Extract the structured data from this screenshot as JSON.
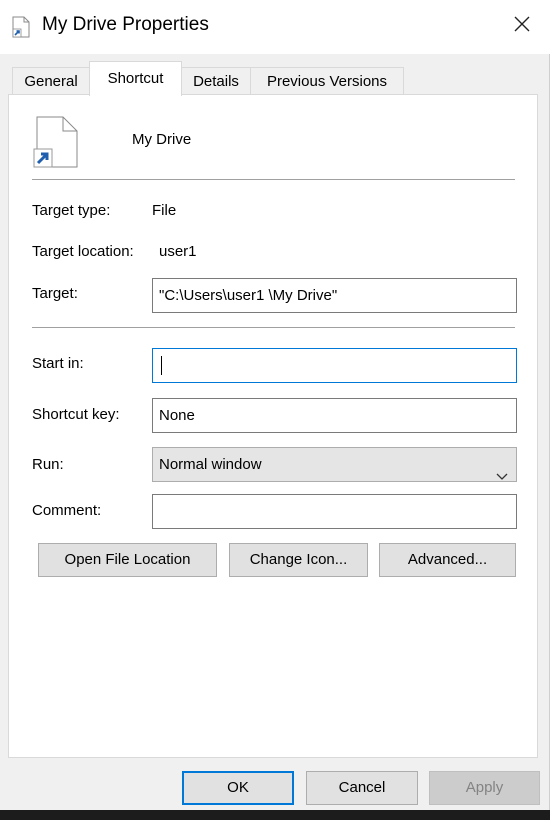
{
  "window": {
    "title": "My Drive Properties"
  },
  "tabs": [
    {
      "label": "General",
      "active": false
    },
    {
      "label": "Shortcut",
      "active": true
    },
    {
      "label": "Details",
      "active": false
    },
    {
      "label": "Previous Versions",
      "active": false
    }
  ],
  "shortcut": {
    "name": "My Drive",
    "target_type_label": "Target type:",
    "target_type_value": "File",
    "target_location_label": "Target location:",
    "target_location_value": "user1",
    "target_label": "Target:",
    "target_value": "\"C:\\Users\\user1 \\My Drive\"",
    "start_in_label": "Start in:",
    "start_in_value": "",
    "shortcut_key_label": "Shortcut key:",
    "shortcut_key_value": "None",
    "run_label": "Run:",
    "run_value": "Normal window",
    "comment_label": "Comment:",
    "comment_value": ""
  },
  "actions": {
    "open_file_location": "Open File Location",
    "change_icon": "Change Icon...",
    "advanced": "Advanced..."
  },
  "footer": {
    "ok": "OK",
    "cancel": "Cancel",
    "apply": "Apply"
  },
  "colors": {
    "accent": "#0078d7",
    "shortcut_arrow": "#1f5fae"
  },
  "icons": {
    "title": "shortcut-file-icon",
    "close": "close-icon",
    "file": "shortcut-file-icon",
    "dropdown": "chevron-down-icon"
  }
}
